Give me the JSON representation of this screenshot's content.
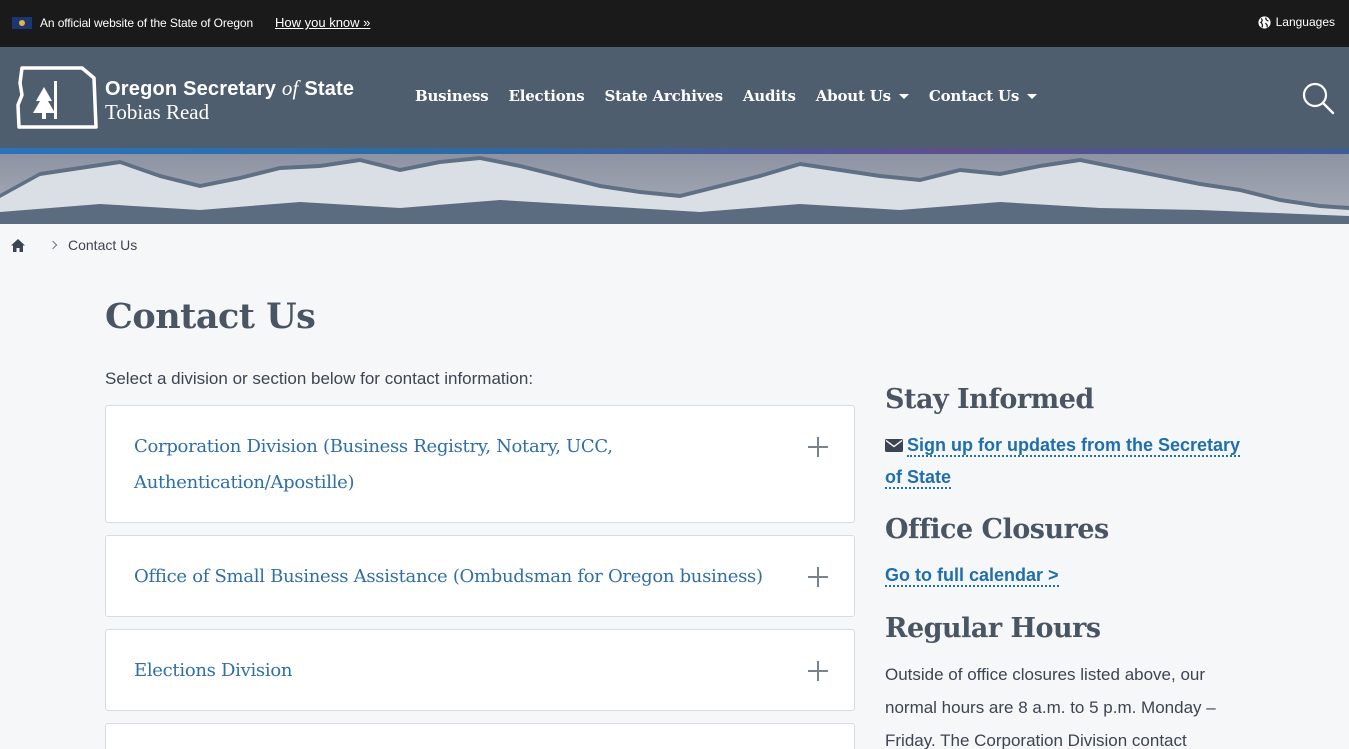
{
  "banner": {
    "official_text": "An official website of the State of Oregon",
    "how_you_know": "How you know »",
    "languages": "Languages"
  },
  "header": {
    "brand_line1_a": "Oregon Secretary ",
    "brand_line1_of": "of",
    "brand_line1_b": " State",
    "brand_line2": "Tobias Read",
    "nav": [
      {
        "label": "Business"
      },
      {
        "label": "Elections"
      },
      {
        "label": "State Archives"
      },
      {
        "label": "Audits"
      },
      {
        "label": "About Us"
      },
      {
        "label": "Contact Us"
      }
    ]
  },
  "breadcrumb": {
    "current": "Contact Us"
  },
  "main": {
    "title": "Contact Us",
    "intro": "Select a division or section below for contact information:",
    "accordions": [
      {
        "title": "Corporation Division (Business Registry, Notary, UCC,",
        "title2": "Authentication/Apostille)"
      },
      {
        "title": "Office of Small Business Assistance (Ombudsman for Oregon business)"
      },
      {
        "title": "Elections Division"
      }
    ]
  },
  "sidebar": {
    "stay_informed": "Stay Informed",
    "signup_line1": "Sign up for updates from the Secretary",
    "signup_line2": "of State",
    "office_closures": "Office Closures",
    "calendar_link": "Go to full calendar >",
    "regular_hours": "Regular Hours",
    "hours_text": "Outside of office closures listed above, our normal hours are 8 a.m. to 5 p.m. Monday – Friday. The Corporation Division contact"
  },
  "colors": {
    "banner_bg": "#1a1a1a",
    "header_bg": "#4f5e6e",
    "link": "#1f6eae",
    "accordion_title": "#2d6fa6"
  }
}
